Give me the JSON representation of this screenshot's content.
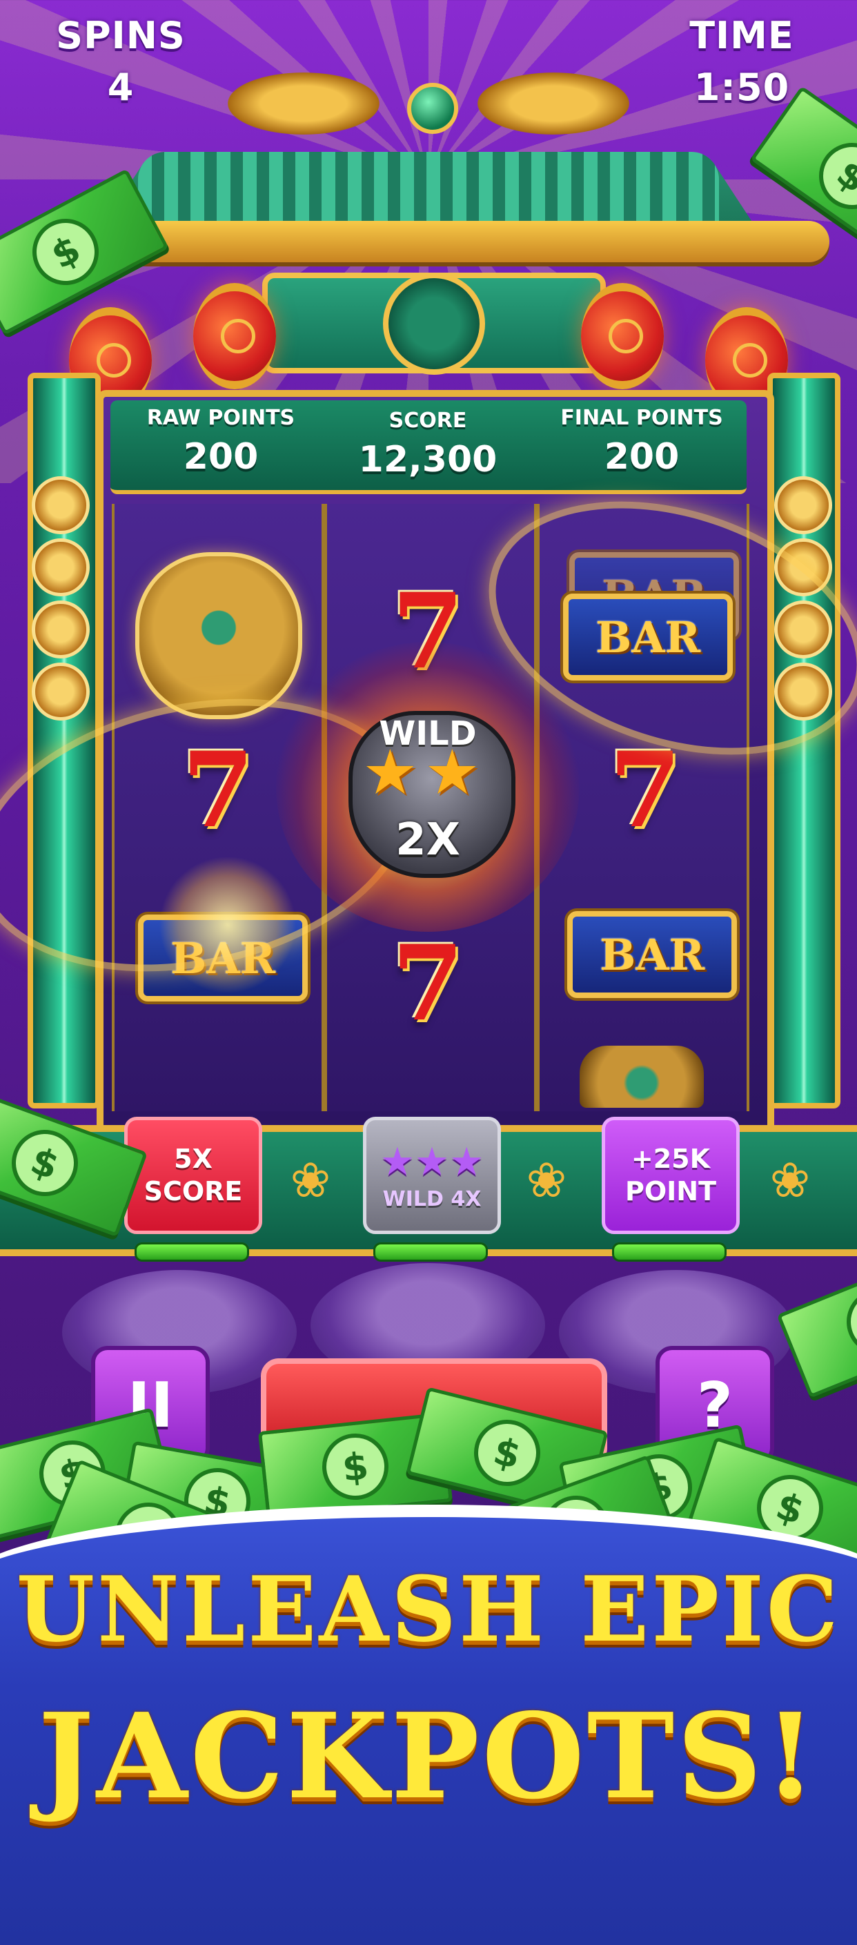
{
  "hud": {
    "spins_label": "SPINS",
    "spins_value": "4",
    "time_label": "TIME",
    "time_value": "1:50"
  },
  "scoreboard": {
    "raw_points_label": "RAW POINTS",
    "raw_points_value": "200",
    "score_label": "SCORE",
    "score_value": "12,300",
    "final_points_label": "FINAL POINTS",
    "final_points_value": "200"
  },
  "reels": {
    "left": [
      "lion-head",
      "7",
      "BAR"
    ],
    "middle": [
      "7",
      "wild",
      "7"
    ],
    "right": [
      "BAR",
      "7",
      "BAR"
    ],
    "bar_text": "BAR",
    "seven_text": "7"
  },
  "wild": {
    "label": "WILD",
    "multiplier": "2X",
    "star_glyph": "★"
  },
  "boosters": [
    {
      "line1": "5X",
      "line2": "SCORE",
      "color": "#e8203c"
    },
    {
      "line1": "WILD 4X",
      "color": "#8e8e9a"
    },
    {
      "line1": "+25K",
      "line2": "POINT",
      "color": "#b43ee8"
    }
  ],
  "controls": {
    "pause_glyph": "II",
    "help_glyph": "?"
  },
  "cash_glyph": "$",
  "lotus_glyph": "❀",
  "tagline": {
    "line1": "UNLEASH EPIC",
    "line2": "JACKPOTS!"
  },
  "colors": {
    "background": "#6a1fb0",
    "jade": "#1f8f69",
    "gold": "#e7b23c",
    "tagline_yellow": "#ffe93a",
    "panel_blue": "#2a3cb8"
  }
}
